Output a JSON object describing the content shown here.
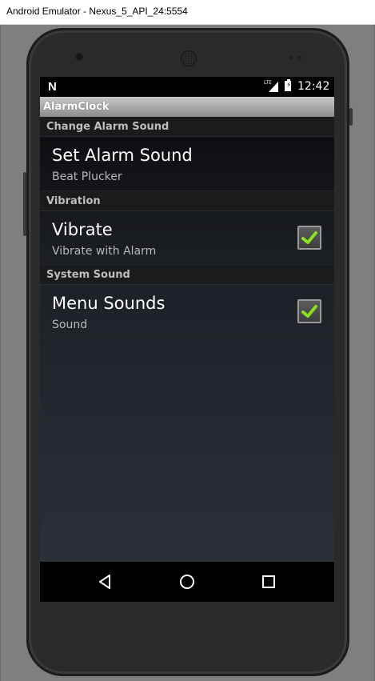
{
  "window": {
    "title": "Android Emulator - Nexus_5_API_24:5554"
  },
  "status_bar": {
    "network_label": "LTE",
    "battery_label": "⚡",
    "time": "12:42"
  },
  "app_bar": {
    "title": "AlarmClock"
  },
  "categories": [
    {
      "title": "Change Alarm Sound"
    },
    {
      "title": "Vibration"
    },
    {
      "title": "System Sound"
    }
  ],
  "preferences": [
    {
      "title": "Set Alarm Sound",
      "summary": "Beat Plucker"
    },
    {
      "title": "Vibrate",
      "summary": "Vibrate with Alarm",
      "checked": true
    },
    {
      "title": "Menu Sounds",
      "summary": "Sound",
      "checked": true
    }
  ],
  "colors": {
    "check": "#8be024",
    "content_top": "#0b0c0e",
    "content_bottom": "#2b2f38"
  },
  "icons": {
    "status_left": "n-icon",
    "signal": "signal-icon",
    "battery": "battery-icon",
    "back": "back-icon",
    "home": "home-icon",
    "recents": "recents-icon"
  }
}
